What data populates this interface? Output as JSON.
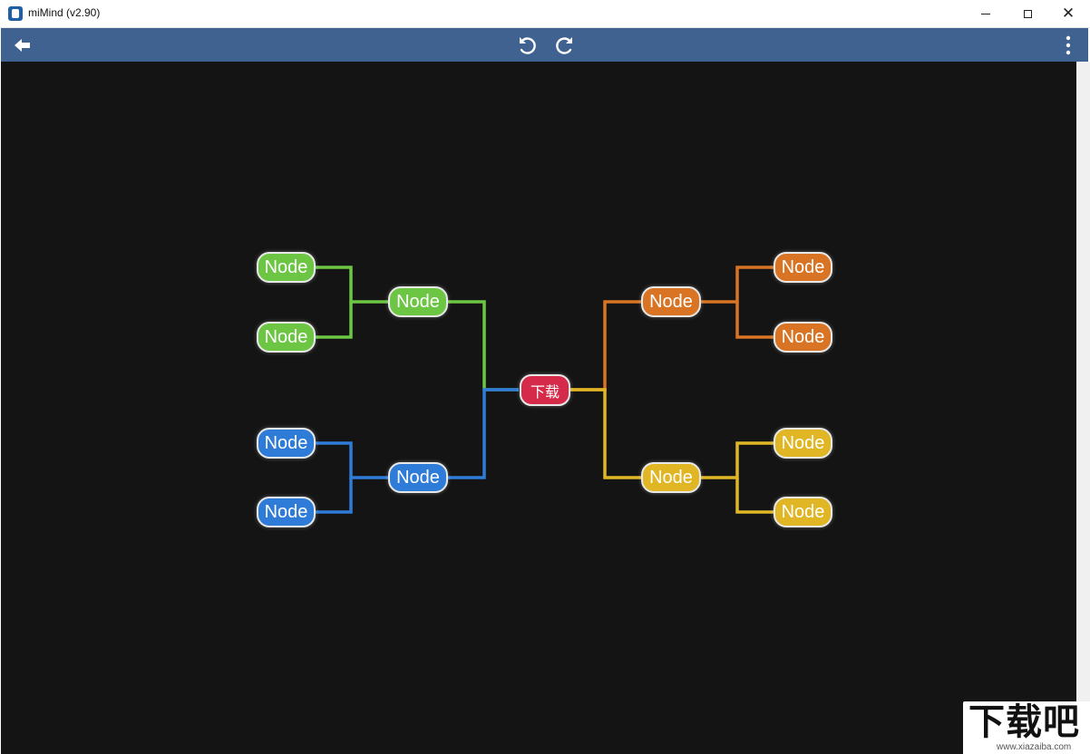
{
  "window": {
    "title": "miMind (v2.90)"
  },
  "icons": {
    "app": "app-icon",
    "back": "arrow-left-icon",
    "undo": "undo-icon",
    "redo": "redo-icon",
    "menu": "more-vertical-icon",
    "minimize": "minimize-icon",
    "maximize": "maximize-icon",
    "close": "close-icon"
  },
  "colors": {
    "appbar": "#3f6291",
    "canvas": "#141414",
    "center": "#d52a4a",
    "green": "#6cc644",
    "blue": "#2e7bd8",
    "orange": "#d87423",
    "yellow": "#e0b624"
  },
  "mindmap": {
    "center": {
      "label": "下载"
    },
    "branches": {
      "green": {
        "label": "Node",
        "children": [
          "Node",
          "Node"
        ]
      },
      "blue": {
        "label": "Node",
        "children": [
          "Node",
          "Node"
        ]
      },
      "orange": {
        "label": "Node",
        "children": [
          "Node",
          "Node"
        ]
      },
      "yellow": {
        "label": "Node",
        "children": [
          "Node",
          "Node"
        ]
      }
    }
  },
  "watermark": {
    "main": "下载吧",
    "sub": "www.xiazaiba.com"
  }
}
